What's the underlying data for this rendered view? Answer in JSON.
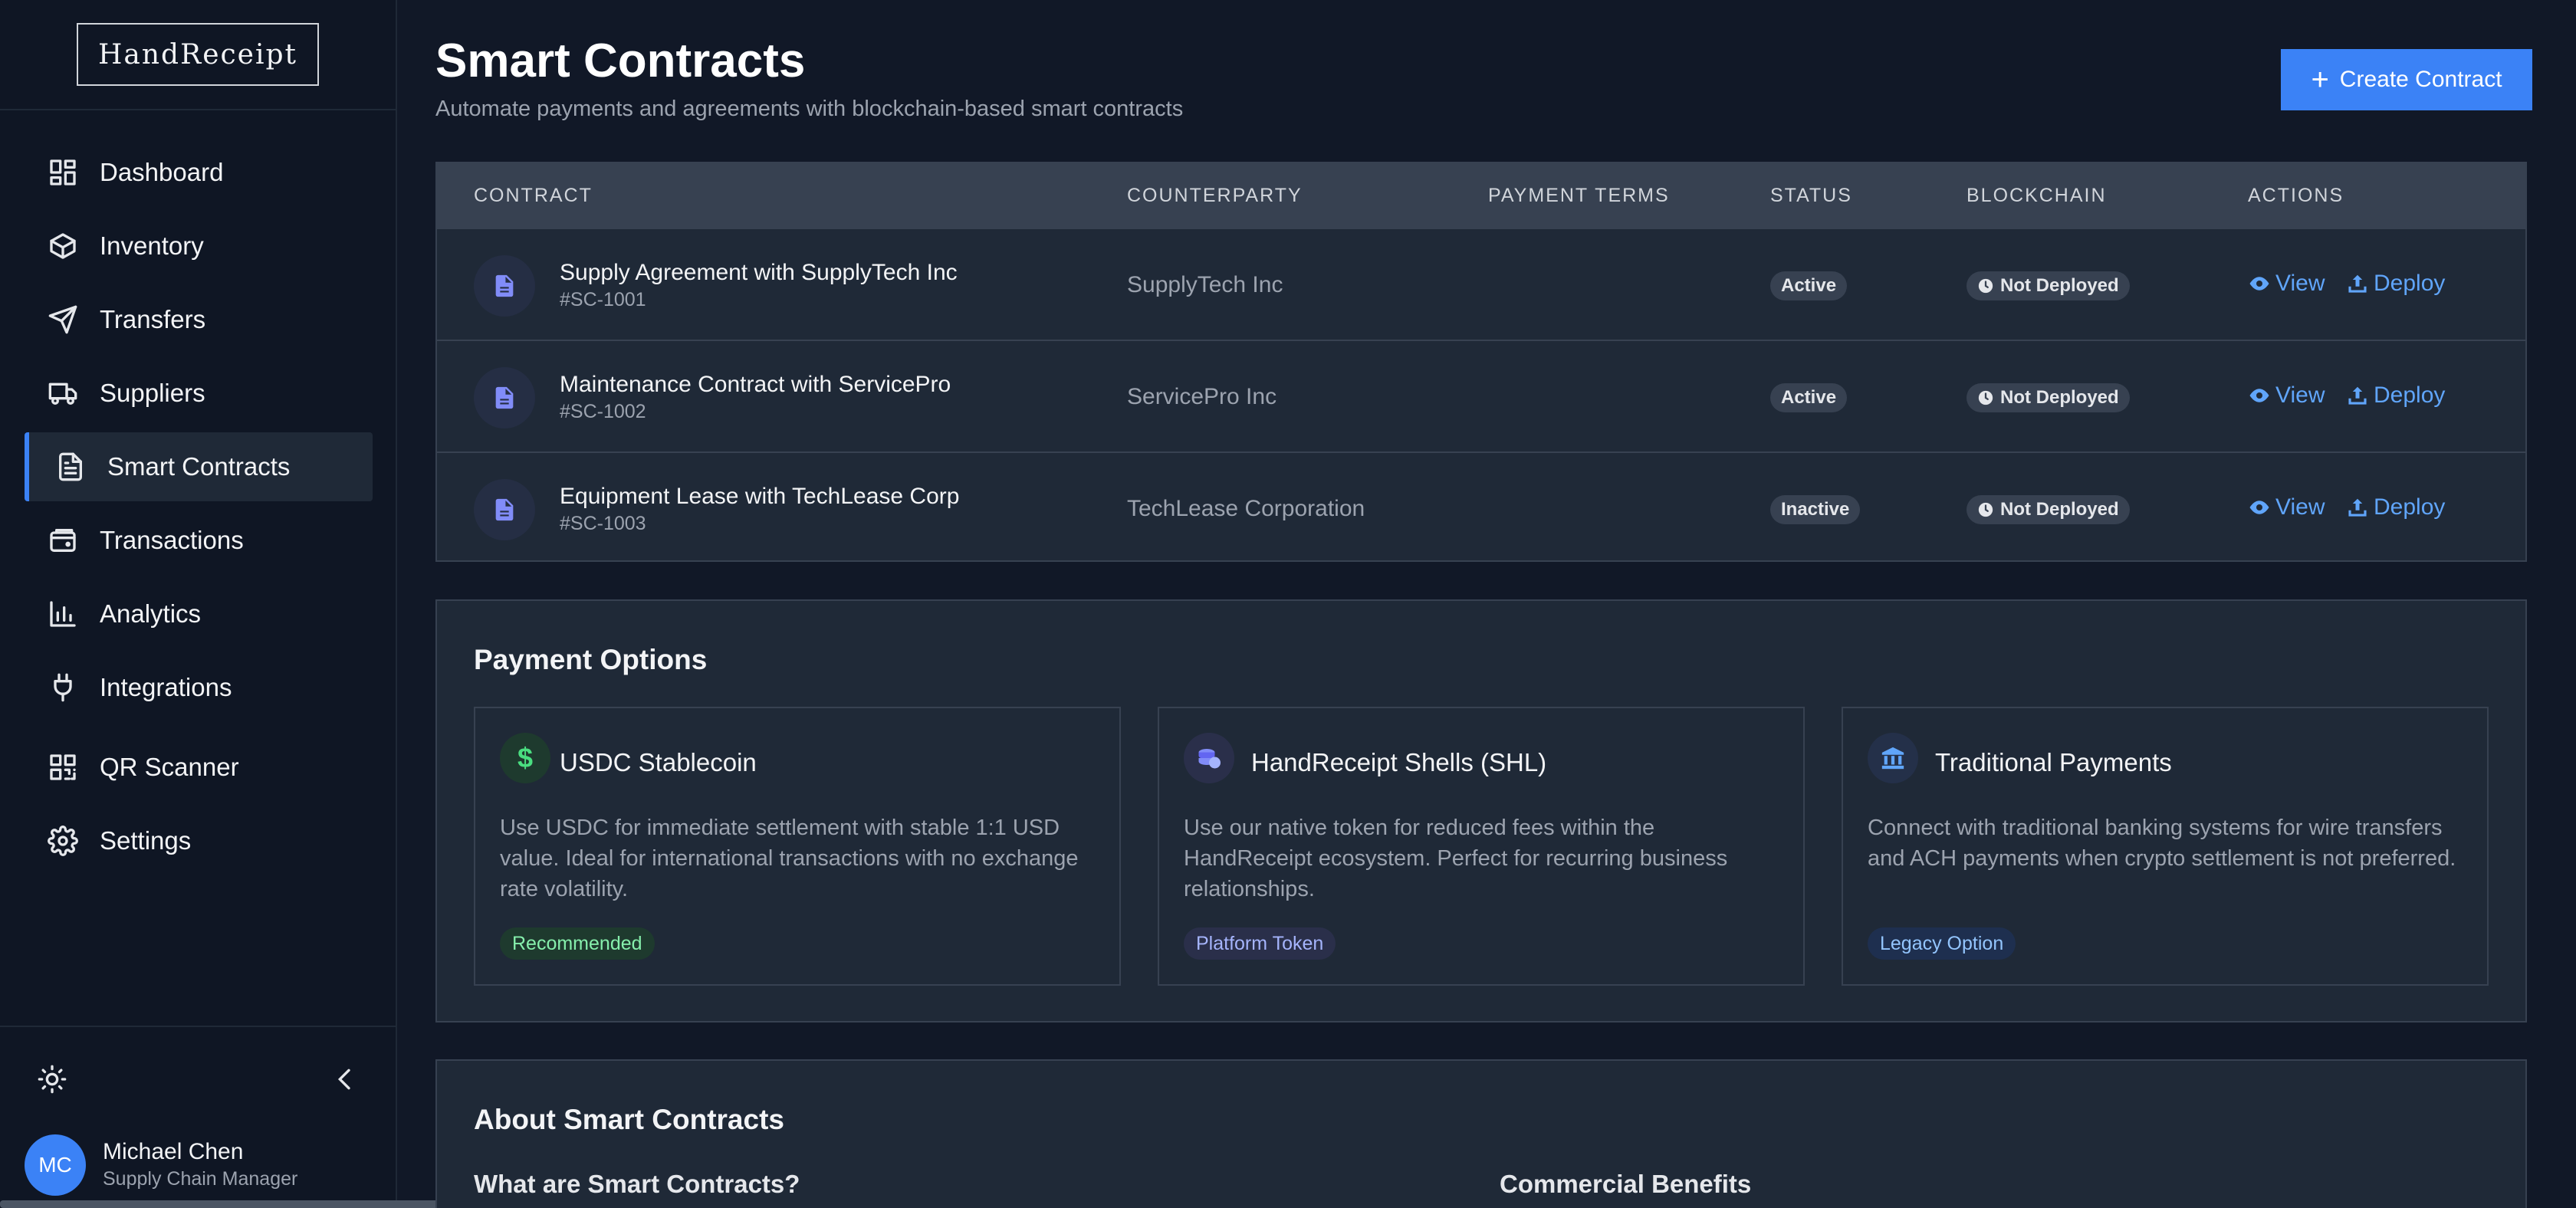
{
  "app": {
    "logo": "HandReceipt"
  },
  "sidebar": {
    "items": [
      {
        "label": "Dashboard",
        "icon": "dashboard-icon"
      },
      {
        "label": "Inventory",
        "icon": "box-icon"
      },
      {
        "label": "Transfers",
        "icon": "send-icon"
      },
      {
        "label": "Suppliers",
        "icon": "truck-icon"
      },
      {
        "label": "Smart Contracts",
        "icon": "document-icon",
        "active": true
      },
      {
        "label": "Transactions",
        "icon": "wallet-icon"
      },
      {
        "label": "Analytics",
        "icon": "bar-chart-icon"
      },
      {
        "label": "Integrations",
        "icon": "plug-icon"
      },
      {
        "label": "QR Scanner",
        "icon": "qr-code-icon"
      },
      {
        "label": "Settings",
        "icon": "gear-icon"
      }
    ],
    "user": {
      "initials": "MC",
      "name": "Michael Chen",
      "role": "Supply Chain Manager"
    }
  },
  "header": {
    "title": "Smart Contracts",
    "subtitle": "Automate payments and agreements with blockchain-based smart contracts",
    "create_label": "Create Contract"
  },
  "table": {
    "columns": [
      "CONTRACT",
      "COUNTERPARTY",
      "PAYMENT TERMS",
      "STATUS",
      "BLOCKCHAIN",
      "ACTIONS"
    ],
    "rows": [
      {
        "name": "Supply Agreement with SupplyTech Inc",
        "id": "#SC-1001",
        "counterparty": "SupplyTech Inc",
        "payment_terms": "",
        "status": "Active",
        "blockchain": "Not Deployed"
      },
      {
        "name": "Maintenance Contract with ServicePro",
        "id": "#SC-1002",
        "counterparty": "ServicePro Inc",
        "payment_terms": "",
        "status": "Active",
        "blockchain": "Not Deployed"
      },
      {
        "name": "Equipment Lease with TechLease Corp",
        "id": "#SC-1003",
        "counterparty": "TechLease Corporation",
        "payment_terms": "",
        "status": "Inactive",
        "blockchain": "Not Deployed"
      }
    ],
    "view_label": "View",
    "deploy_label": "Deploy"
  },
  "payment_options": {
    "title": "Payment Options",
    "cards": [
      {
        "title": "USDC Stablecoin",
        "description": "Use USDC for immediate settlement with stable 1:1 USD value. Ideal for international transactions with no exchange rate volatility.",
        "tag": "Recommended",
        "icon": "dollar-icon"
      },
      {
        "title": "HandReceipt Shells (SHL)",
        "description": "Use our native token for reduced fees within the HandReceipt ecosystem. Perfect for recurring business relationships.",
        "tag": "Platform Token",
        "icon": "coins-icon"
      },
      {
        "title": "Traditional Payments",
        "description": "Connect with traditional banking systems for wire transfers and ACH payments when crypto settlement is not preferred.",
        "tag": "Legacy Option",
        "icon": "bank-icon"
      }
    ]
  },
  "about": {
    "title": "About Smart Contracts",
    "left_heading": "What are Smart Contracts?",
    "right_heading": "Commercial Benefits"
  },
  "colors": {
    "accent": "#3b82f6",
    "link": "#60a5fa",
    "bg": "#111827",
    "panel": "#1f2937"
  }
}
